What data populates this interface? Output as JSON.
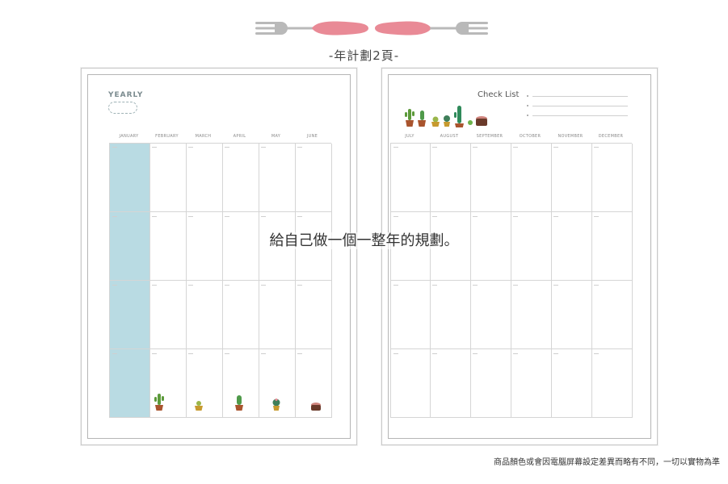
{
  "header": {
    "subtitle": "-年計劃2頁-",
    "ornament": "fork-and-spoon-divider"
  },
  "left_page": {
    "title": "YEARLY",
    "months": [
      "JANUARY",
      "FEBRUARY",
      "MARCH",
      "APRIL",
      "MAY",
      "JUNE"
    ],
    "highlight_color": "#b9dbe3",
    "decor": [
      "cactus-icon",
      "potted-plant-icon",
      "cactus-icon",
      "round-cactus-icon",
      "succulent-pot-icon"
    ]
  },
  "right_page": {
    "checklist_title": "Check List",
    "months": [
      "JULY",
      "AUGUST",
      "SEPTEMBER",
      "OCTOBER",
      "NOVEMBER",
      "DECEMBER"
    ],
    "decor": [
      "cactus-row-illustration"
    ]
  },
  "overlay_caption": "給自己做一個一整年的規劃。",
  "footer_note": "商品顏色或會因電腦屏幕設定差異而略有不同，一切以實物為準",
  "colors": {
    "accent_pink": "#e98a96",
    "fork_gray": "#b9b9b9",
    "cactus_green": "#5c9a3a",
    "pot_brown": "#a9542e"
  }
}
